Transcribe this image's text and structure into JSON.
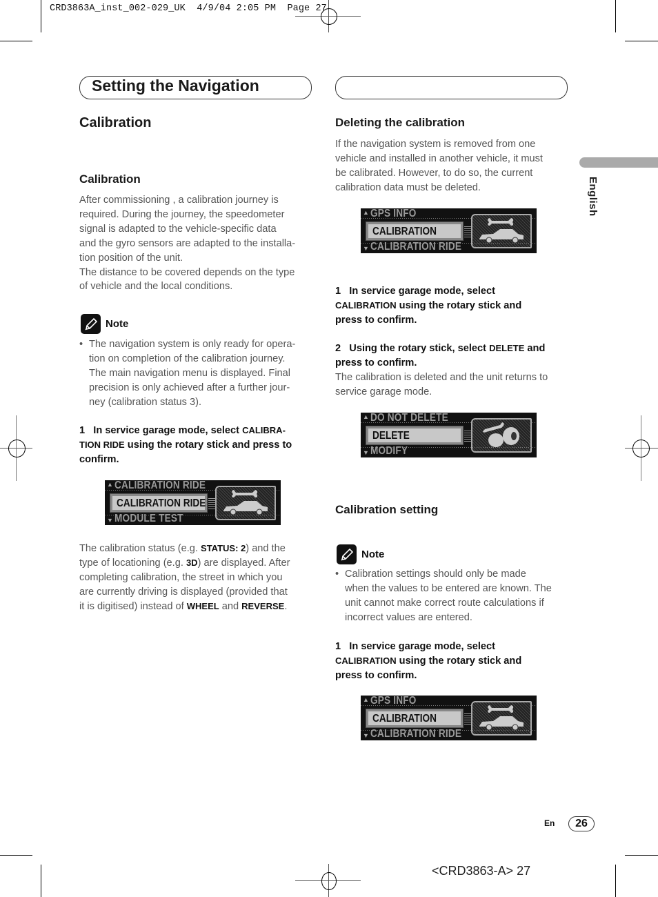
{
  "print_header": "CRD3863A_inst_002-029_UK  4/9/04 2:05 PM  Page 27",
  "section_title": "Setting the Navigation",
  "left": {
    "heading": "Calibration",
    "subheading": "Calibration",
    "intro_paragraph_lines": [
      "After commissioning , a calibration journey is",
      "required. During the journey, the speedometer",
      "signal is adapted to the vehicle-specific data",
      "and the gyro sensors are adapted to the installa-",
      "tion position of the unit.",
      "The distance to be covered depends on the type",
      "of vehicle and the local conditions."
    ],
    "note": {
      "label": "Note",
      "bullet_lines": [
        "The navigation system is only ready for opera-",
        "tion on completion of the calibration journey.",
        "The main navigation menu is displayed. Final",
        "precision is only achieved after a further jour-",
        "ney (calibration status 3)."
      ]
    },
    "step1": {
      "number": "1",
      "line1_pre": "In service garage mode, select ",
      "line1_sc": "CALIBRA-",
      "line2_sc": "TION RIDE",
      "line2_post": " using the rotary stick and press to",
      "line3": "confirm."
    },
    "lcd": {
      "top_item": "CALIBRATION RIDE",
      "selected_item": "CALIBRATION RIDE",
      "bottom_item": "MODULE TEST",
      "icon": "wrench-car-icon"
    },
    "status_paragraph": {
      "l1_pre": "The calibration status (e.g. ",
      "l1_bold": "STATUS: 2",
      "l1_post": ") and the",
      "l2_pre": "type of locationing (e.g. ",
      "l2_bold": "3D",
      "l2_post": ") are displayed. After",
      "l3": "completing calibration, the street in which you",
      "l4": "are currently driving is displayed (provided that",
      "l5_pre": "it is digitised) instead of ",
      "l5_bold1": "WHEEL",
      "l5_mid": " and ",
      "l5_bold2": "REVERSE",
      "l5_post": "."
    }
  },
  "right": {
    "deleting": {
      "heading": "Deleting the calibration",
      "paragraph_lines": [
        "If the navigation system is removed from one",
        "vehicle and installed in another vehicle, it must",
        "be calibrated. However, to do so, the current",
        "calibration data must be deleted."
      ],
      "lcd1": {
        "top_item": "GPS INFO",
        "selected_item": "CALIBRATION",
        "bottom_item": "CALIBRATION RIDE",
        "icon": "wrench-car-icon"
      },
      "step1": {
        "number": "1",
        "line1": "In service garage mode, select",
        "line2_sc": "CALIBRATION",
        "line2_post": " using the rotary stick and",
        "line3": "press to confirm."
      },
      "step2": {
        "number": "2",
        "line1_pre": "Using the rotary stick, select ",
        "line1_sc": "DELETE",
        "line1_post": " and",
        "line2": "press to confirm."
      },
      "result_lines": [
        "The calibration is deleted and the unit returns to",
        "service garage mode."
      ],
      "lcd2": {
        "top_item": "DO NOT DELETE",
        "selected_item": "DELETE",
        "bottom_item": "MODIFY",
        "icon": "wrench-tyres-icon"
      }
    },
    "setting": {
      "heading": "Calibration setting",
      "note": {
        "label": "Note",
        "bullet_lines": [
          "Calibration settings should only be made",
          "when the values to be entered are known. The",
          "unit cannot make correct route calculations if",
          "incorrect values are entered."
        ]
      },
      "step1": {
        "number": "1",
        "line1": "In service garage mode, select",
        "line2_sc": "CALIBRATION",
        "line2_post": " using the rotary stick and",
        "line3": "press to confirm."
      },
      "lcd": {
        "top_item": "GPS INFO",
        "selected_item": "CALIBRATION",
        "bottom_item": "CALIBRATION RIDE",
        "icon": "wrench-car-icon"
      }
    }
  },
  "side_tab": {
    "label": "English"
  },
  "footer": {
    "lang": "En",
    "page_number": "26",
    "doc_code": "<CRD3863-A> 27"
  }
}
